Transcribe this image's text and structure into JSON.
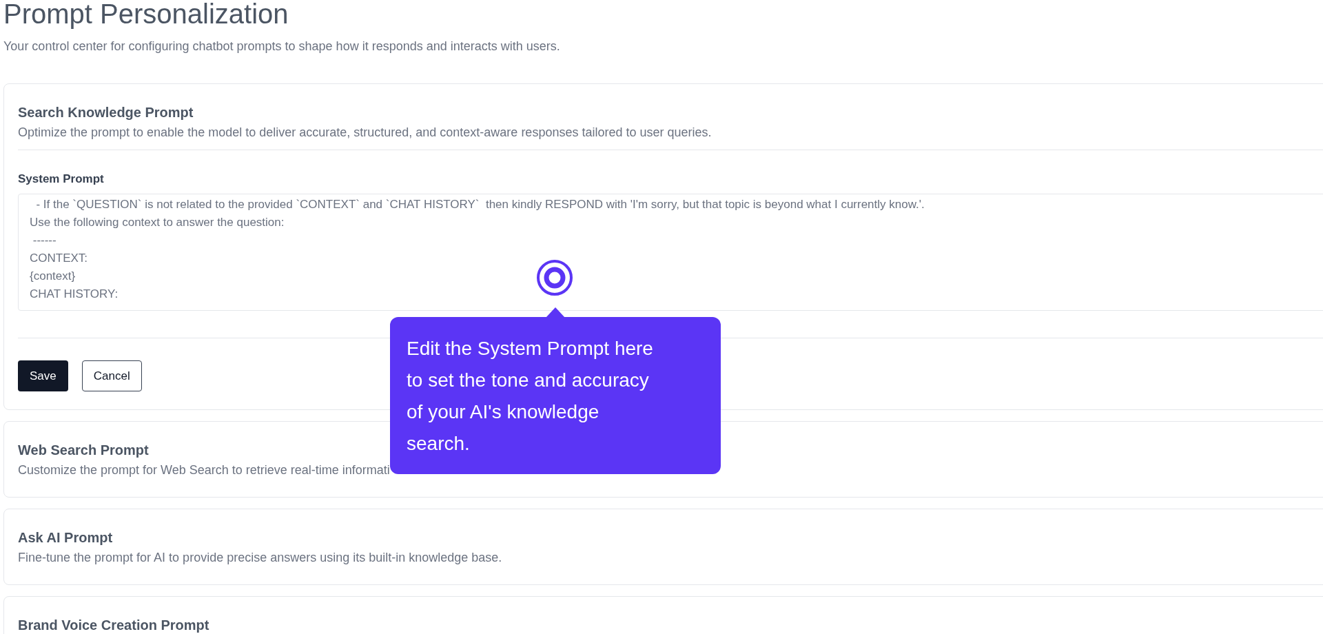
{
  "page": {
    "title": "Prompt Personalization",
    "subtitle": "Your control center for configuring chatbot prompts to shape how it responds and interacts with users."
  },
  "sections": [
    {
      "title": "Search Knowledge Prompt",
      "description": "Optimize the prompt to enable the model to deliver accurate, structured, and context-aware responses tailored to user queries.",
      "expanded": true,
      "editor": {
        "label": "System Prompt",
        "value": "  - If the `QUESTION` is not related to the provided `CONTEXT` and `CHAT HISTORY`  then kindly RESPOND with 'I'm sorry, but that topic is beyond what I currently know.'.\nUse the following context to answer the question:\n ------\nCONTEXT:\n{context}\nCHAT HISTORY:",
        "buttons": [
          {
            "label": "Save",
            "kind": "primary"
          },
          {
            "label": "Cancel",
            "kind": "secondary"
          }
        ]
      }
    },
    {
      "title": "Web Search Prompt",
      "description": "Customize the prompt for Web Search to retrieve real-time informati",
      "expanded": false
    },
    {
      "title": "Ask AI Prompt",
      "description": "Fine-tune the prompt for AI to provide precise answers using its built-in knowledge base.",
      "expanded": false
    },
    {
      "title": "Brand Voice Creation Prompt",
      "expanded": false
    }
  ],
  "tooltip": {
    "text": "Edit the System Prompt here to set the tone and accuracy of your AI's knowledge search."
  }
}
